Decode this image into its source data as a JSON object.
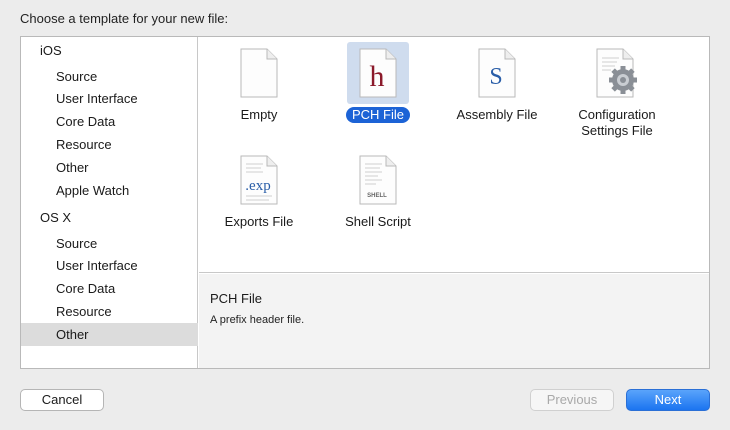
{
  "heading": "Choose a template for your new file:",
  "sidebar": {
    "items": [
      {
        "label": "iOS",
        "kind": "group",
        "selected": false
      },
      {
        "label": "Source",
        "kind": "item",
        "selected": false
      },
      {
        "label": "User Interface",
        "kind": "item",
        "selected": false
      },
      {
        "label": "Core Data",
        "kind": "item",
        "selected": false
      },
      {
        "label": "Resource",
        "kind": "item",
        "selected": false
      },
      {
        "label": "Other",
        "kind": "item",
        "selected": false
      },
      {
        "label": "Apple Watch",
        "kind": "item",
        "selected": false
      },
      {
        "label": "OS X",
        "kind": "group",
        "selected": false
      },
      {
        "label": "Source",
        "kind": "item",
        "selected": false
      },
      {
        "label": "User Interface",
        "kind": "item",
        "selected": false
      },
      {
        "label": "Core Data",
        "kind": "item",
        "selected": false
      },
      {
        "label": "Resource",
        "kind": "item",
        "selected": false
      },
      {
        "label": "Other",
        "kind": "item",
        "selected": true
      }
    ]
  },
  "templates": [
    {
      "label": "Empty",
      "icon": "empty-file-icon",
      "selected": false
    },
    {
      "label": "PCH File",
      "icon": "pch-file-icon",
      "glyph": "h",
      "selected": true
    },
    {
      "label": "Assembly File",
      "icon": "assembly-file-icon",
      "glyph": "S",
      "selected": false
    },
    {
      "label": "Configuration\nSettings File",
      "icon": "gear-file-icon",
      "selected": false
    },
    {
      "label": "Exports File",
      "icon": "exports-file-icon",
      "glyph": ".exp",
      "selected": false
    },
    {
      "label": "Shell Script",
      "icon": "shell-script-icon",
      "glyph": "SHELL",
      "selected": false
    }
  ],
  "detail": {
    "title": "PCH File",
    "description": "A prefix header file."
  },
  "buttons": {
    "cancel": "Cancel",
    "previous": "Previous",
    "next": "Next"
  },
  "colors": {
    "accent": "#1c63d6",
    "selection_row": "#dcdcdc",
    "tile_selection": "#cfdcee",
    "pch_glyph": "#8b1a2b",
    "assembly_glyph": "#2a5ea8"
  }
}
